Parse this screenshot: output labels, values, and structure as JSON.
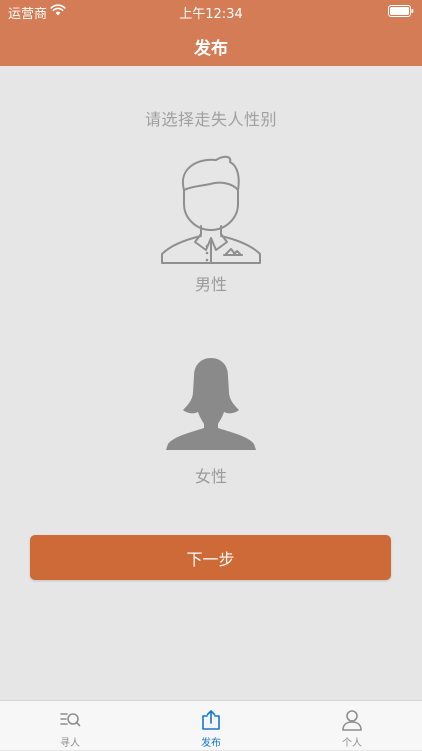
{
  "status_bar": {
    "carrier": "运营商",
    "time": "上午12:34"
  },
  "header": {
    "title": "发布"
  },
  "main": {
    "prompt": "请选择走失人性别",
    "options": [
      {
        "label": "男性",
        "icon": "male-avatar-icon"
      },
      {
        "label": "女性",
        "icon": "female-avatar-icon"
      }
    ],
    "next_button": "下一步"
  },
  "tabbar": {
    "items": [
      {
        "label": "寻人",
        "icon": "search-list-icon",
        "active": false
      },
      {
        "label": "发布",
        "icon": "share-upload-icon",
        "active": true
      },
      {
        "label": "个人",
        "icon": "person-icon",
        "active": false
      }
    ]
  },
  "colors": {
    "header": "#d37c55",
    "button": "#cd6a38",
    "background": "#e6e6e6",
    "tab_active": "#1976d2",
    "tab_inactive": "#8e8e8e"
  }
}
